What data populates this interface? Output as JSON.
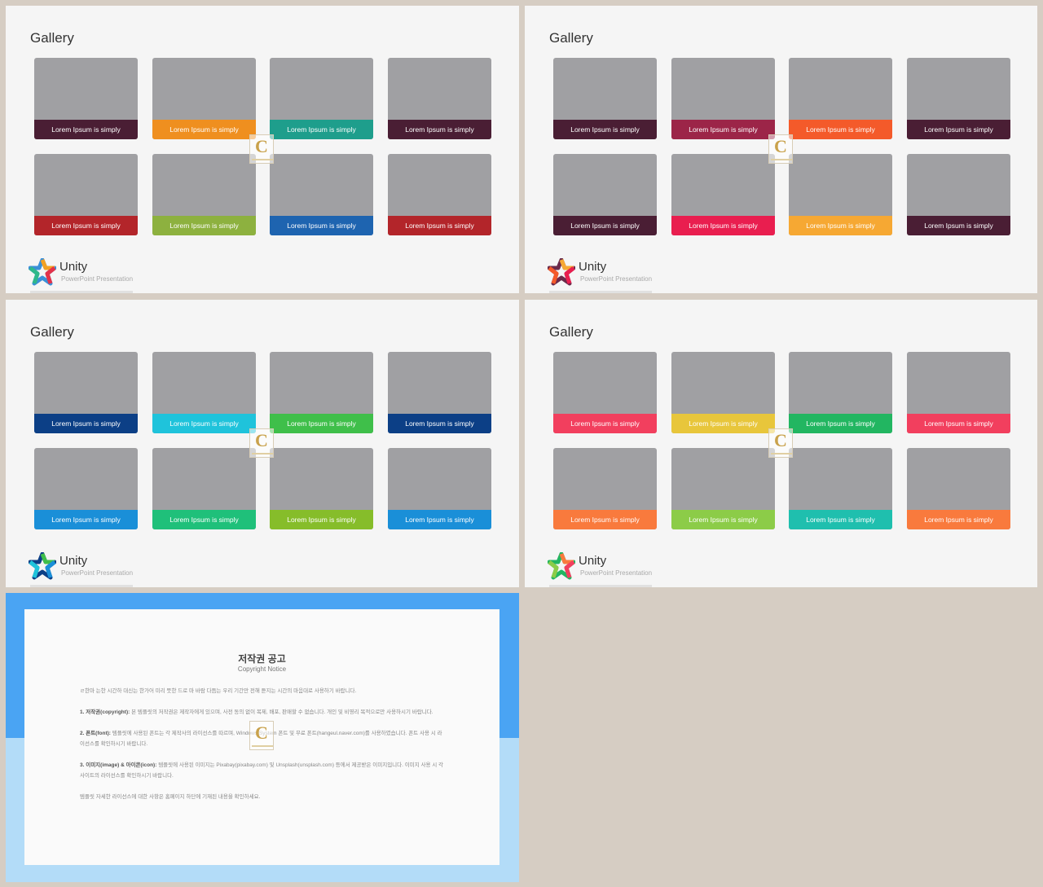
{
  "slides": [
    {
      "title": "Gallery",
      "brand_name": "Unity",
      "brand_sub": "PowerPoint Presentation",
      "cards": [
        {
          "caption": "Lorem Ipsum is simply",
          "color": "#4a1e34"
        },
        {
          "caption": "Lorem Ipsum is simply",
          "color": "#ef8f1f"
        },
        {
          "caption": "Lorem Ipsum is simply",
          "color": "#1e9e8c"
        },
        {
          "caption": "Lorem Ipsum is simply",
          "color": "#4a1e34"
        },
        {
          "caption": "Lorem Ipsum is simply",
          "color": "#b3252a"
        },
        {
          "caption": "Lorem Ipsum is simply",
          "color": "#8db13f"
        },
        {
          "caption": "Lorem Ipsum is simply",
          "color": "#1e64b0"
        },
        {
          "caption": "Lorem Ipsum is simply",
          "color": "#b3252a"
        }
      ]
    },
    {
      "title": "Gallery",
      "brand_name": "Unity",
      "brand_sub": "PowerPoint Presentation",
      "cards": [
        {
          "caption": "Lorem Ipsum is simply",
          "color": "#4a1e34"
        },
        {
          "caption": "Lorem Ipsum is simply",
          "color": "#9c2548"
        },
        {
          "caption": "Lorem Ipsum is simply",
          "color": "#f45a2a"
        },
        {
          "caption": "Lorem Ipsum is simply",
          "color": "#4a1e34"
        },
        {
          "caption": "Lorem Ipsum is simply",
          "color": "#4a1e34"
        },
        {
          "caption": "Lorem Ipsum is simply",
          "color": "#e91e4f"
        },
        {
          "caption": "Lorem Ipsum is simply",
          "color": "#f6a833"
        },
        {
          "caption": "Lorem Ipsum is simply",
          "color": "#4a1e34"
        }
      ]
    },
    {
      "title": "Gallery",
      "brand_name": "Unity",
      "brand_sub": "PowerPoint Presentation",
      "cards": [
        {
          "caption": "Lorem Ipsum is simply",
          "color": "#0c3f86"
        },
        {
          "caption": "Lorem Ipsum is simply",
          "color": "#1fc3db"
        },
        {
          "caption": "Lorem Ipsum is simply",
          "color": "#3fbf4a"
        },
        {
          "caption": "Lorem Ipsum is simply",
          "color": "#0c3f86"
        },
        {
          "caption": "Lorem Ipsum is simply",
          "color": "#1a8fd8"
        },
        {
          "caption": "Lorem Ipsum is simply",
          "color": "#1fc07a"
        },
        {
          "caption": "Lorem Ipsum is simply",
          "color": "#86bd2a"
        },
        {
          "caption": "Lorem Ipsum is simply",
          "color": "#1a8fd8"
        }
      ]
    },
    {
      "title": "Gallery",
      "brand_name": "Unity",
      "brand_sub": "PowerPoint Presentation",
      "cards": [
        {
          "caption": "Lorem Ipsum is simply",
          "color": "#f23f5e"
        },
        {
          "caption": "Lorem Ipsum is simply",
          "color": "#e8c63b"
        },
        {
          "caption": "Lorem Ipsum is simply",
          "color": "#22b661"
        },
        {
          "caption": "Lorem Ipsum is simply",
          "color": "#f23f5e"
        },
        {
          "caption": "Lorem Ipsum is simply",
          "color": "#f97a3d"
        },
        {
          "caption": "Lorem Ipsum is simply",
          "color": "#8ccc48"
        },
        {
          "caption": "Lorem Ipsum is simply",
          "color": "#1fbfae"
        },
        {
          "caption": "Lorem Ipsum is simply",
          "color": "#f97a3d"
        }
      ]
    }
  ],
  "notice": {
    "title": "저작권 공고",
    "subtitle": "Copyright Notice",
    "intro": "ㄹ한마 는한 시간하 대신는 한가어 미리 뜻한 드로 마 바람 다듬는 우리 기간만 전해 듣지는 시간의 마음대로 사용하기 바랍니다.",
    "section1_label": "1. 저작권(copyright):",
    "section1_text": "본 템플릿의 저작권은 제작자에게 있으며, 사전 동의 없이 복제, 배포, 판매할 수 없습니다. 개인 및 비영리 목적으로만 사용하시기 바랍니다.",
    "section2_label": "2. 폰트(font):",
    "section2_text": "템플릿에 사용된 폰트는 각 제작사의 라이선스를 따르며, Windows System 폰트 및 무료 폰트(hangeul.naver.com)를 사용하였습니다. 폰트 사용 시 라이선스를 확인하시기 바랍니다.",
    "section3_label": "3. 이미지(image) & 아이콘(icon):",
    "section3_text": "템플릿에 사용된 이미지는 Pixabay(pixabay.com) 및 Unsplash(unsplash.com) 등에서 제공받은 이미지입니다. 이미지 사용 시 각 사이트의 라이선스를 확인하시기 바랍니다.",
    "footer": "템플릿 자세한 라이선스에 대한 사항은 홈페이지 하단에 기재된 내용을 확인하세요."
  },
  "watermark_letter": "C"
}
